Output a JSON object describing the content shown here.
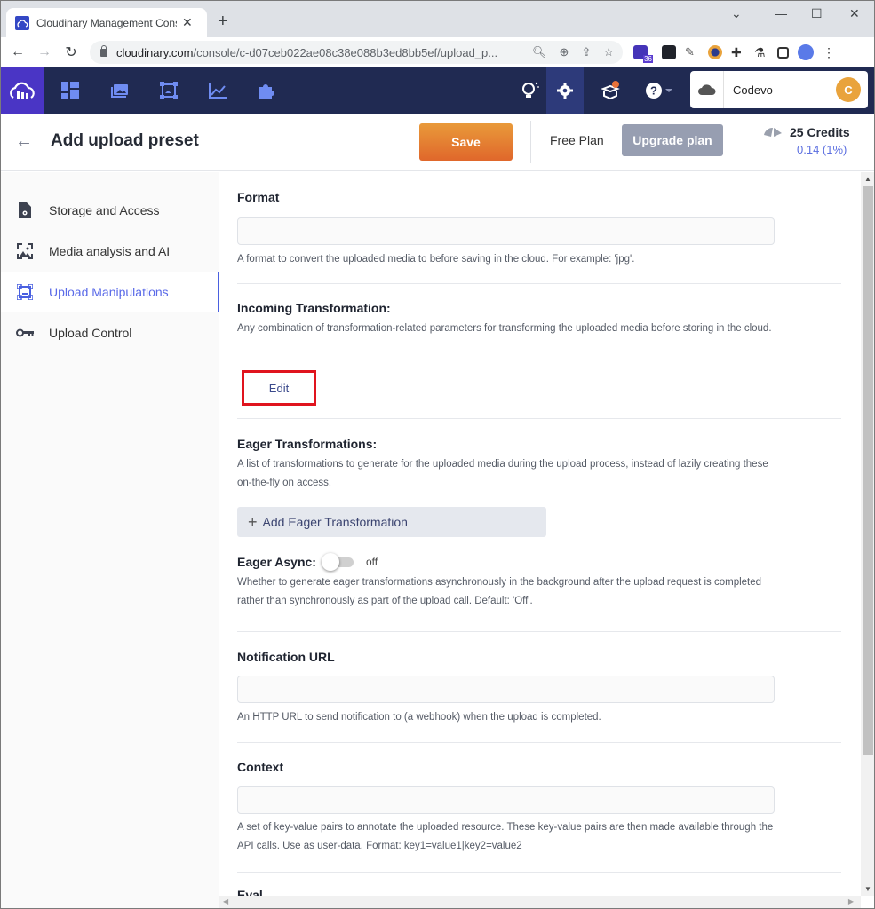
{
  "browser": {
    "tab_title": "Cloudinary Management Console",
    "new_tab_label": "+",
    "url_host": "cloudinary.com",
    "url_path": "/console/c-d07ceb022ae08c38e088b3ed8bb5ef/upload_p...",
    "extension_badge": "36"
  },
  "appnav": {
    "account_name": "Codevo",
    "avatar_initial": "C",
    "colors": {
      "bg": "#202a52",
      "logo_bg": "#4a35c5",
      "icon": "#6f8cf2",
      "notification_dot": "#e8733a"
    }
  },
  "header": {
    "title": "Add upload preset",
    "save_label": "Save",
    "plan_label": "Free Plan",
    "upgrade_label": "Upgrade plan",
    "credits_label": "25 Credits",
    "credits_usage": "0.14 (1%)"
  },
  "sidebar": {
    "items": [
      {
        "label": "Storage and Access",
        "icon": "file-gear-icon",
        "active": false
      },
      {
        "label": "Media analysis and AI",
        "icon": "image-scan-icon",
        "active": false
      },
      {
        "label": "Upload Manipulations",
        "icon": "transform-frame-icon",
        "active": true
      },
      {
        "label": "Upload Control",
        "icon": "key-icon",
        "active": false
      }
    ]
  },
  "main": {
    "format": {
      "title": "Format",
      "value": "",
      "help": "A format to convert the uploaded media to before saving in the cloud. For example: 'jpg'."
    },
    "incoming": {
      "title": "Incoming Transformation:",
      "help": "Any combination of transformation-related parameters for transforming the uploaded media before storing in the cloud.",
      "edit_label": "Edit"
    },
    "eager": {
      "title": "Eager Transformations:",
      "help": "A list of transformations to generate for the uploaded media during the upload process, instead of lazily creating these on-the-fly on access.",
      "add_label": "Add Eager Transformation"
    },
    "eager_async": {
      "title": "Eager Async:",
      "state": "off",
      "help": "Whether to generate eager transformations asynchronously in the background after the upload request is completed rather than synchronously as part of the upload call. Default: 'Off'."
    },
    "notification": {
      "title": "Notification URL",
      "value": "",
      "help": "An HTTP URL to send notification to (a webhook) when the upload is completed."
    },
    "context": {
      "title": "Context",
      "value": "",
      "help": "A set of key-value pairs to annotate the uploaded resource. These key-value pairs are then made available through the API calls. Use as user-data. Format: key1=value1|key2=value2"
    },
    "next_section_partial": "Eval"
  }
}
